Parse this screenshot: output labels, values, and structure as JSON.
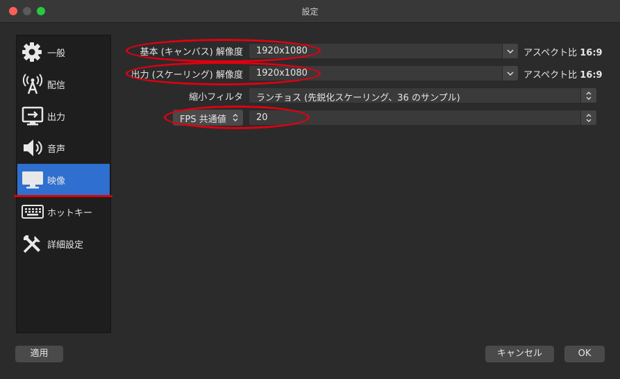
{
  "window": {
    "title": "設定"
  },
  "sidebar": {
    "items": [
      {
        "label": "一般",
        "icon": "gear-icon"
      },
      {
        "label": "配信",
        "icon": "broadcast-icon"
      },
      {
        "label": "出力",
        "icon": "output-icon"
      },
      {
        "label": "音声",
        "icon": "speaker-icon"
      },
      {
        "label": "映像",
        "icon": "monitor-icon",
        "active": true
      },
      {
        "label": "ホットキー",
        "icon": "keyboard-icon"
      },
      {
        "label": "詳細設定",
        "icon": "tools-icon"
      }
    ]
  },
  "video": {
    "base_resolution": {
      "label": "基本 (キャンバス) 解像度",
      "value": "1920x1080",
      "aspect_label": "アスペクト比",
      "aspect_value": "16:9"
    },
    "output_resolution": {
      "label": "出力 (スケーリング) 解像度",
      "value": "1920x1080",
      "aspect_label": "アスペクト比",
      "aspect_value": "16:9"
    },
    "downscale_filter": {
      "label": "縮小フィルタ",
      "value": "ランチョス (先鋭化スケーリング、36 のサンプル)"
    },
    "fps": {
      "label": "FPS 共通値",
      "value": "20"
    }
  },
  "footer": {
    "apply_label": "適用",
    "cancel_label": "キャンセル",
    "ok_label": "OK"
  },
  "colors": {
    "accent": "#2e6fd0",
    "annotation_red": "#e00010"
  }
}
